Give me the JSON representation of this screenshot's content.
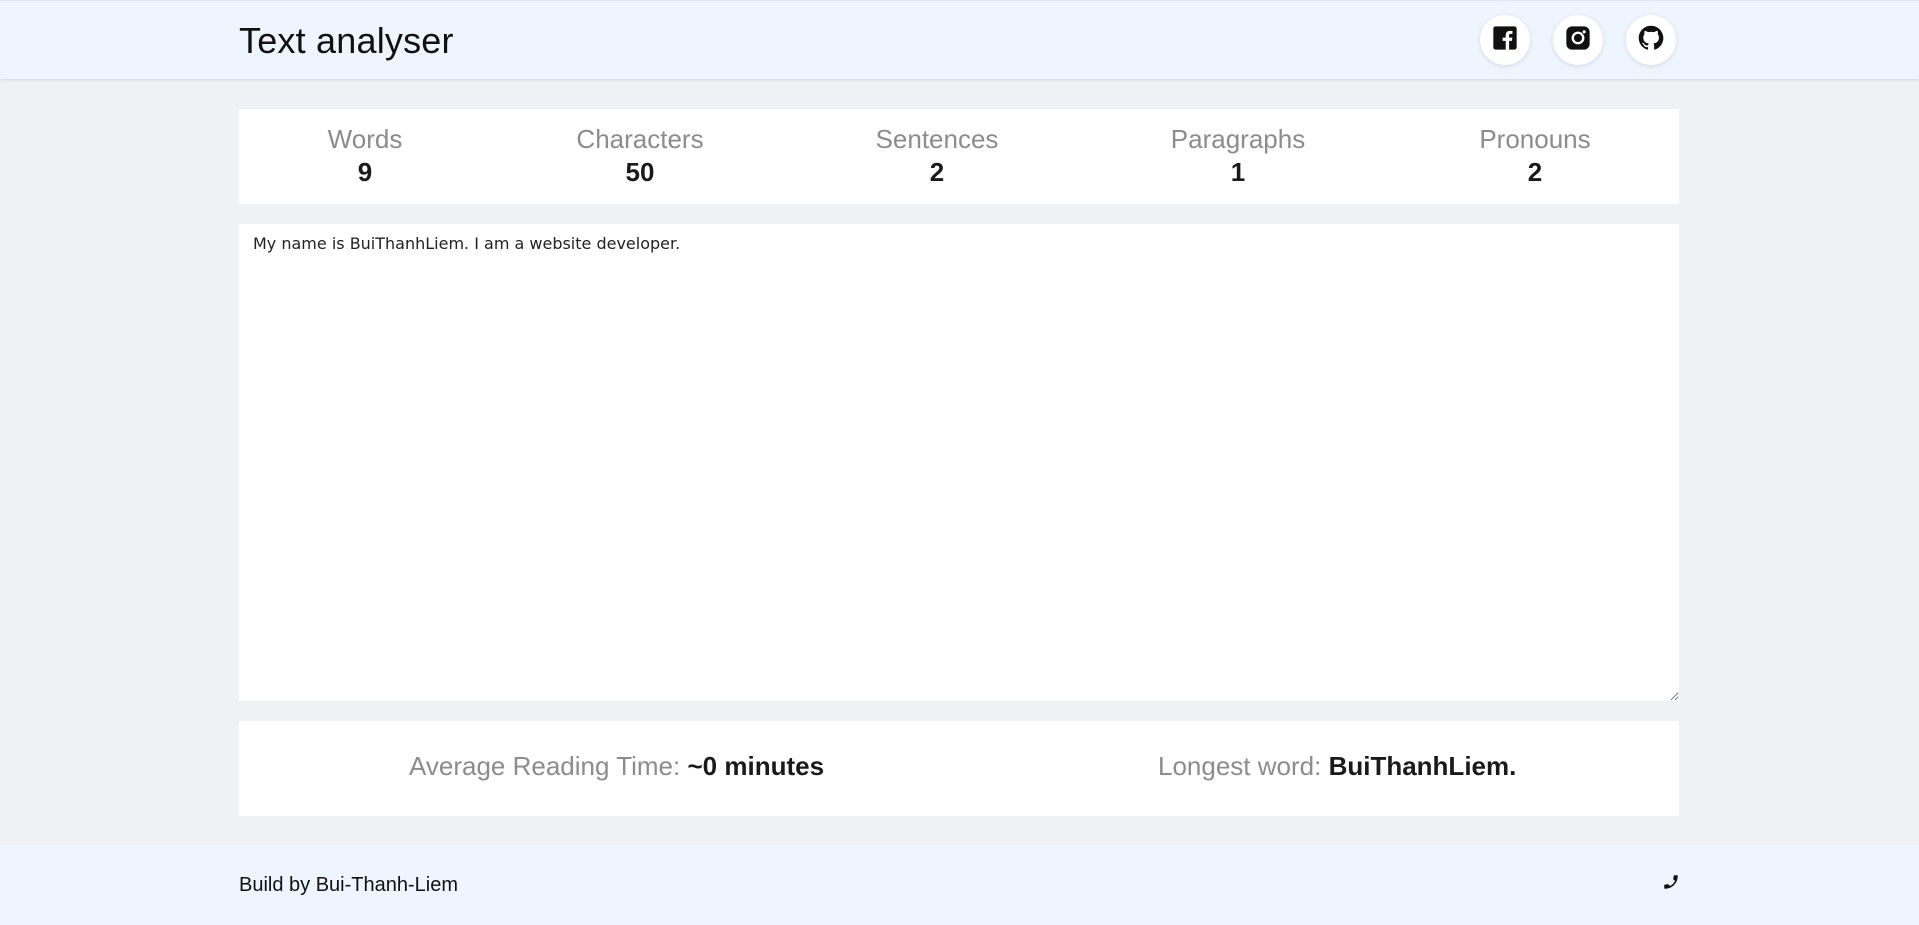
{
  "header": {
    "title": "Text analyser",
    "social": [
      {
        "icon": "facebook-icon"
      },
      {
        "icon": "instagram-icon"
      },
      {
        "icon": "github-icon"
      }
    ]
  },
  "stats": [
    {
      "label": "Words",
      "value": "9"
    },
    {
      "label": "Characters",
      "value": "50"
    },
    {
      "label": "Sentences",
      "value": "2"
    },
    {
      "label": "Paragraphs",
      "value": "1"
    },
    {
      "label": "Pronouns",
      "value": "2"
    }
  ],
  "editor": {
    "value": "My name is BuiThanhLiem. I am a website developer."
  },
  "summary": {
    "reading_time_label": "Average Reading Time:",
    "reading_time_value": "~0 minutes",
    "longest_word_label": "Longest word:",
    "longest_word_value": "BuiThanhLiem."
  },
  "footer": {
    "text": "Build by Bui-Thanh-Liem",
    "icon": "phone-icon"
  },
  "colors": {
    "header_bg": "#eef5fe",
    "page_bg": "#f0f1f4",
    "muted_label": "#8c8c8c"
  }
}
